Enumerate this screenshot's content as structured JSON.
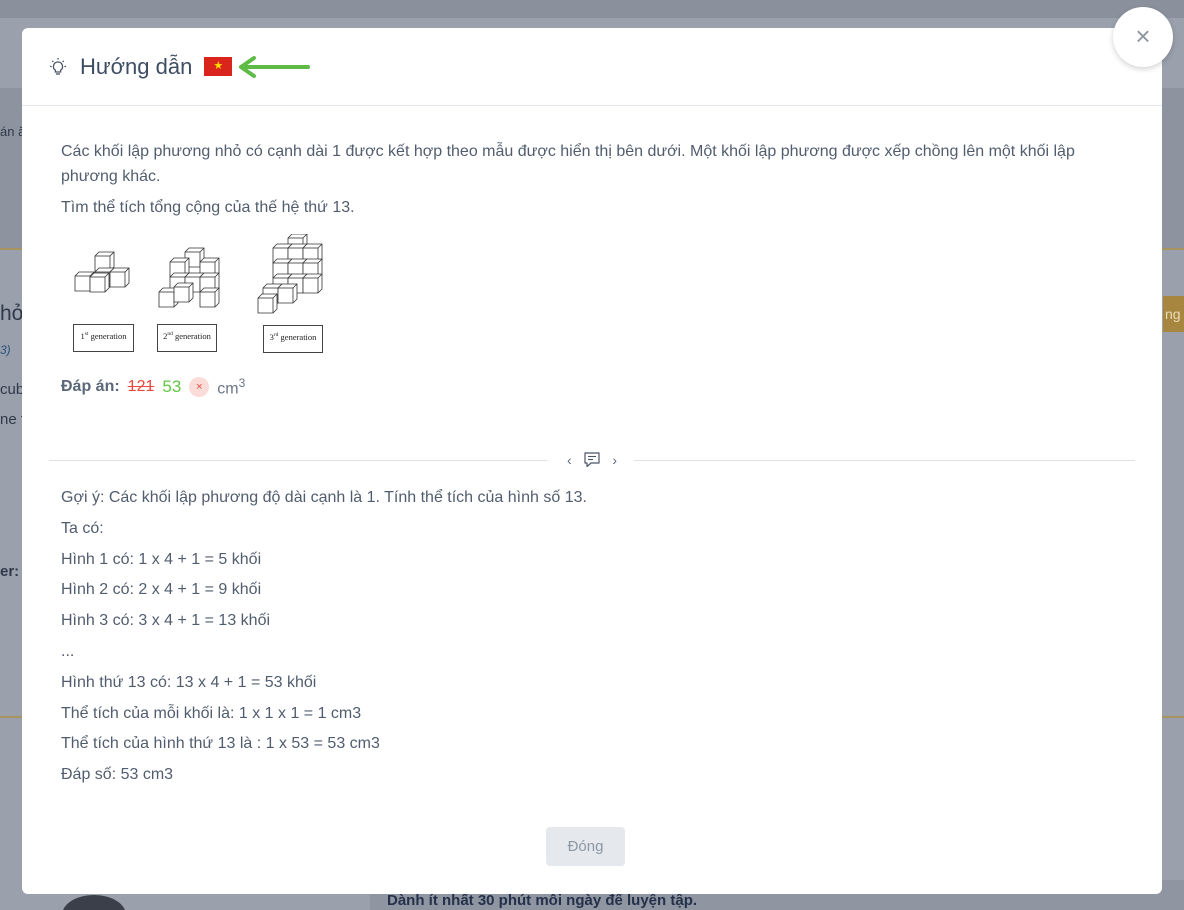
{
  "background": {
    "fragments": [
      "án ă",
      "hỏ",
      "3)",
      "cub",
      "ne t",
      "er:"
    ],
    "side_button_label": "ng",
    "banner_text": "Dành ít nhất 30 phút mỗi ngày để luyện tập."
  },
  "modal": {
    "title": "Hướng dẫn",
    "icons": {
      "title_icon": "lightbulb-icon",
      "flag": "vietnam-flag-icon",
      "pointer": "green-arrow-icon"
    },
    "close_symbol": "×",
    "question": {
      "paragraph_1": "Các khối lập phương nhỏ có cạnh dài 1 được kết hợp theo mẫu được hiển thị bên dưới. Một khối lập phương được xếp chồng lên một khối lập phương khác.",
      "paragraph_2": "Tìm thể tích tổng cộng của thế hệ thứ 13.",
      "figure": {
        "gen1_ord": "1",
        "gen1_sup": "st",
        "gen1_word": "generation",
        "gen2_ord": "2",
        "gen2_sup": "nd",
        "gen2_word": "generation",
        "gen3_ord": "3",
        "gen3_sup": "rd",
        "gen3_word": "generation"
      }
    },
    "answer": {
      "label": "Đáp án:",
      "wrong_value": "121",
      "correct_value": "53",
      "wrong_icon": "×",
      "unit": "cm",
      "unit_exp": "3"
    },
    "divider": {
      "prev": "‹",
      "next": "›"
    },
    "hint_lines": [
      "Gợi ý: Các khối lập phương độ dài cạnh là 1. Tính thể tích của hình số 13.",
      "Ta có:",
      "Hình 1 có: 1 x 4 + 1 = 5 khối",
      "Hình 2 có: 2 x 4 + 1 = 9 khối",
      "Hình 3 có: 3 x 4 + 1 = 13 khối",
      "...",
      "Hình thứ 13 có: 13 x 4 + 1 = 53 khối",
      "Thể tích của mỗi khối là: 1 x 1 x 1 = 1 cm3",
      "Thể tích của hình thứ 13 là : 1 x 53 = 53 cm3",
      "Đáp số: 53 cm3"
    ],
    "footer_button": "Đóng"
  },
  "colors": {
    "accent_correct": "#62c544",
    "accent_wrong": "#e8493b",
    "arrow": "#5dbb46",
    "flag_red": "#da251d",
    "flag_star": "#ffde00"
  }
}
